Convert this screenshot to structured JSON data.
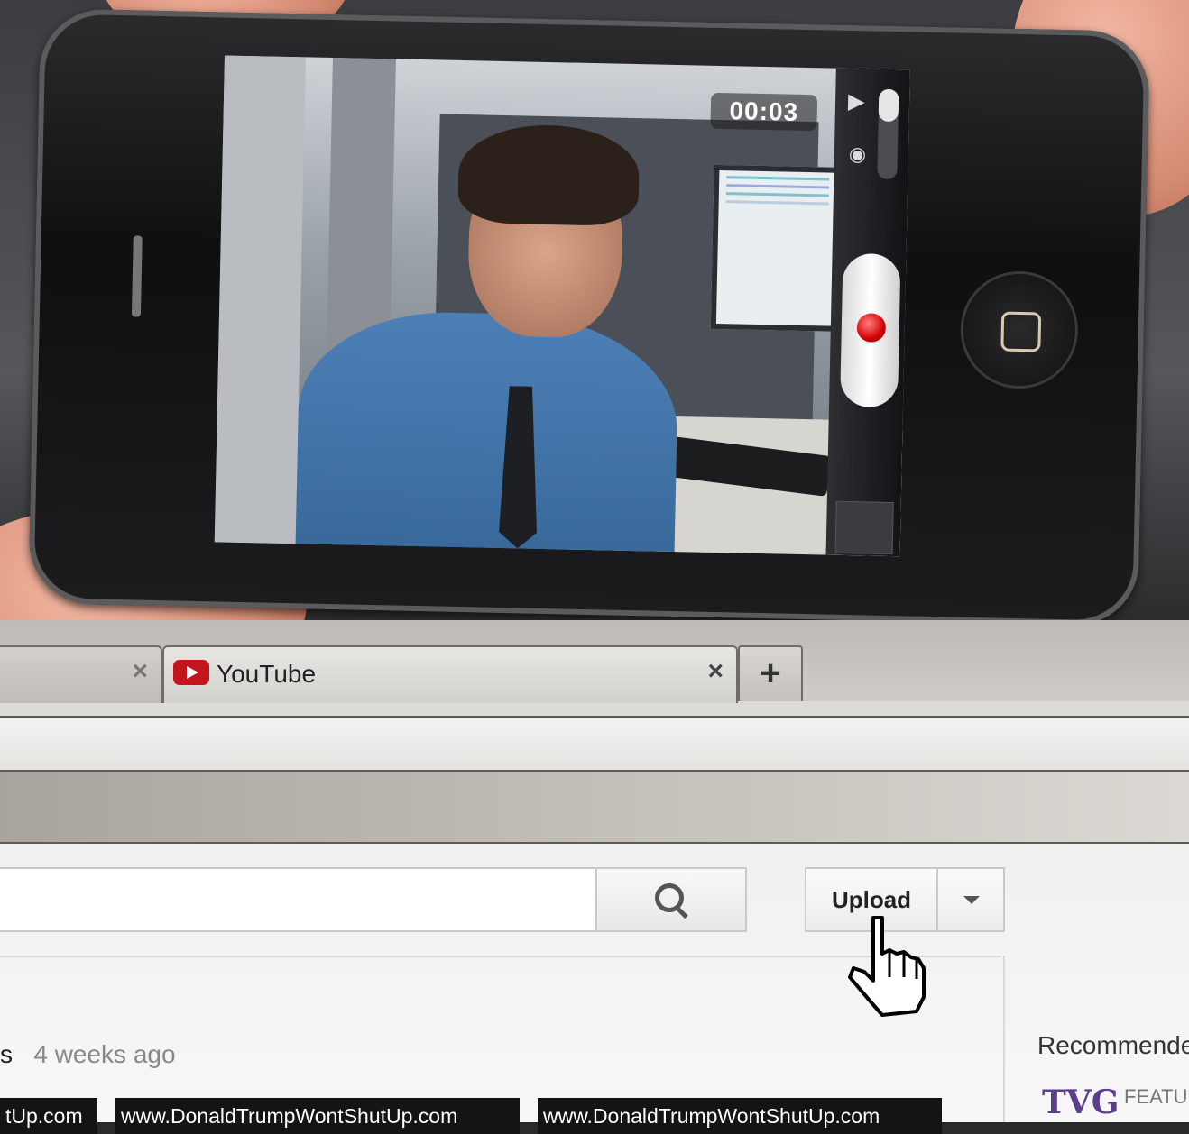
{
  "camera": {
    "timer": "00:03",
    "video_icon": "video-camera-icon",
    "photo_icon": "camera-icon",
    "record_button_color": "#d40000"
  },
  "browser": {
    "tabs": [
      {
        "label": "",
        "active": false
      },
      {
        "label": "YouTube",
        "active": true
      }
    ],
    "new_tab_label": "+",
    "close_label": "×"
  },
  "youtube": {
    "search_placeholder": "",
    "upload_label": "Upload",
    "video_meta_prefix": "s",
    "video_age": "4 weeks ago",
    "recommended_label": "Recommende",
    "featured_label": "FEATU",
    "chips": [
      "tUp.com",
      "www.DonaldTrumpWontShutUp.com",
      "www.DonaldTrumpWontShutUp.com"
    ]
  }
}
